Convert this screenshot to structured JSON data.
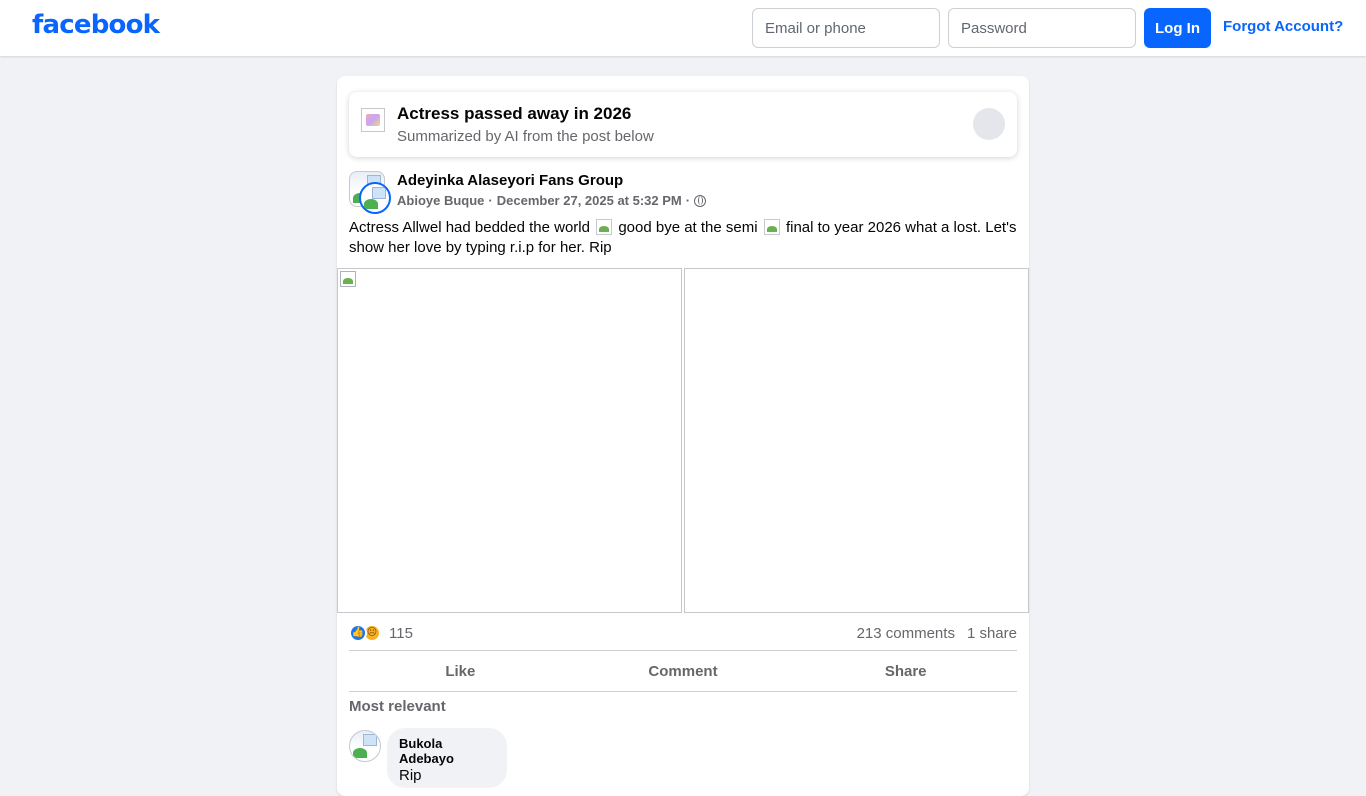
{
  "header": {
    "logo_text": "facebook",
    "email_placeholder": "Email or phone",
    "password_placeholder": "Password",
    "login_label": "Log In",
    "forgot_label": "Forgot Account?"
  },
  "ai_summary": {
    "title": "Actress passed away in 2026",
    "subtitle": "Summarized by AI from the post below"
  },
  "post": {
    "group_name": "Adeyinka Alaseyori Fans Group",
    "author": "Abioye Buque",
    "separator": " · ",
    "timestamp": "December 27, 2025 at 5:32 PM",
    "text_part1": "Actress Allwel had bedded the world",
    "text_part2": "good bye at the semi",
    "text_part3": "final to year 2026 what a lost. Let's show her love by typing r.i.p for her. Rip"
  },
  "stats": {
    "reaction_count": "115",
    "comments": "213 comments",
    "shares": "1 share"
  },
  "actions": {
    "like": "Like",
    "comment": "Comment",
    "share": "Share"
  },
  "comments": {
    "sort_label": "Most relevant",
    "items": [
      {
        "name": "Bukola Adebayo",
        "text": "Rip"
      }
    ]
  },
  "colors": {
    "brand": "#0866ff",
    "background": "#f0f2f5",
    "secondary_text": "#65676b"
  }
}
